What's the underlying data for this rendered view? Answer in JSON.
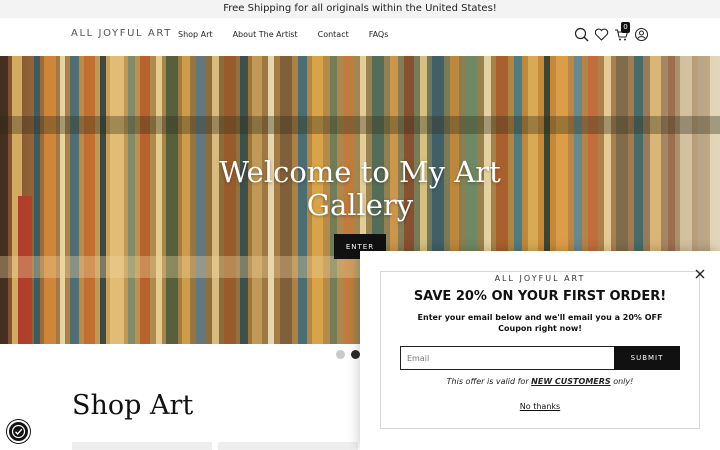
{
  "announcement": {
    "text": "Free Shipping for all originals within the United States!"
  },
  "header": {
    "logo": "ALL JOYFUL ART",
    "nav": [
      "Shop Art",
      "About The Artist",
      "Contact",
      "FAQs"
    ],
    "icons": [
      "search-icon",
      "heart-icon",
      "cart-icon",
      "account-icon"
    ],
    "cart_count": "0"
  },
  "hero": {
    "title": "Welcome to My Art Gallery",
    "button_label": "ENTER",
    "slides": 2,
    "active_slide": 2
  },
  "main": {
    "section_title": "Shop Art"
  },
  "popup": {
    "brand": "ALL JOYFUL ART",
    "heading": "SAVE 20% ON YOUR FIRST ORDER!",
    "subtext": "Enter your email below and we'll email you a 20% OFF Coupon right now!",
    "email_placeholder": "Email",
    "submit_label": "SUBMIT",
    "offer_prefix": "This offer is valid for ",
    "offer_emphasis": "NEW CUSTOMERS",
    "offer_suffix": " only!",
    "dismiss_label": "No thanks"
  },
  "colors": {
    "accent": "#111111",
    "announcement_bg": "#f3f3f3"
  }
}
